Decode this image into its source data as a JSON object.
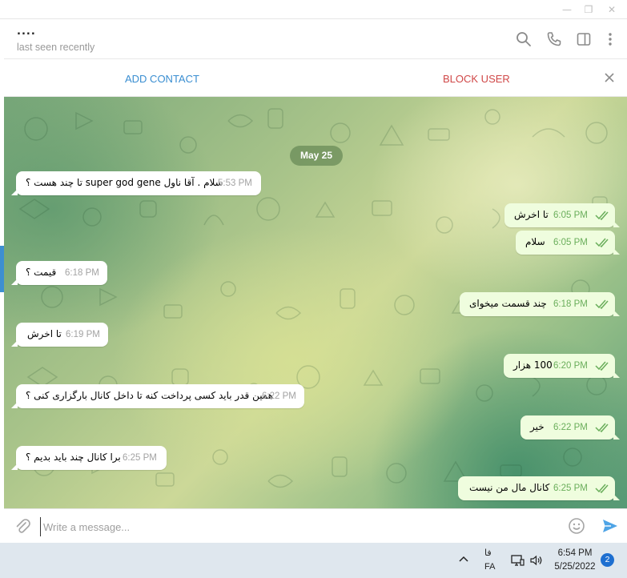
{
  "window": {
    "minimize_glyph": "—",
    "restore_glyph": "❐",
    "close_glyph": "✕"
  },
  "header": {
    "peer_name": "....",
    "status": "last seen recently",
    "icons": [
      "search-icon",
      "phone-icon",
      "sidebar-toggle-icon",
      "more-vertical-icon"
    ]
  },
  "action_bar": {
    "add_contact": "ADD CONTACT",
    "block_user": "BLOCK USER"
  },
  "chat": {
    "date": "May 25",
    "messages": [
      {
        "dir": "in",
        "text": "سلام . آقا ناول super god gene تا چند هست ؟",
        "time": "5:53 PM"
      },
      {
        "dir": "out",
        "text": "تا اخرش",
        "time": "6:05 PM"
      },
      {
        "dir": "out",
        "text": "سلام",
        "time": "6:05 PM"
      },
      {
        "dir": "in",
        "text": "قیمت ؟",
        "time": "6:18 PM"
      },
      {
        "dir": "out",
        "text": "چند قسمت میخوای",
        "time": "6:18 PM"
      },
      {
        "dir": "in",
        "text": "تا اخرش",
        "time": "6:19 PM"
      },
      {
        "dir": "out",
        "text": "100 هزار",
        "time": "6:20 PM"
      },
      {
        "dir": "in",
        "text": "همین قدر باید کسی پرداخت کنه تا داخل کانال بارگزاری کنی ؟",
        "time": "6:22 PM"
      },
      {
        "dir": "out",
        "text": "خیر",
        "time": "6:22 PM"
      },
      {
        "dir": "in",
        "text": "برا کانال چند باید بدیم ؟",
        "time": "6:25 PM"
      },
      {
        "dir": "out",
        "text": "کانال مال من نیست",
        "time": "6:25 PM"
      }
    ]
  },
  "composer": {
    "placeholder": "Write a message...",
    "value": ""
  },
  "taskbar": {
    "lang_native": "فا",
    "lang_code": "FA",
    "time": "6:54 PM",
    "date": "5/25/2022",
    "notifications": "2"
  },
  "colors": {
    "accent": "#3a8ed1",
    "danger": "#d04848",
    "outgoing_bubble": "#effdde",
    "read_ticks": "#6aae5b"
  }
}
